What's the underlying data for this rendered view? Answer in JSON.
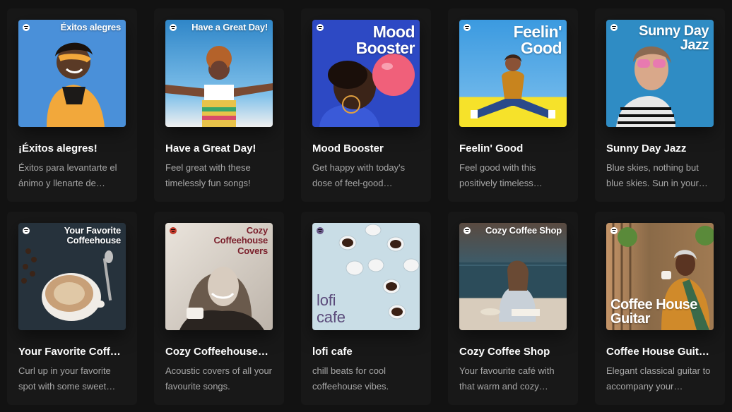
{
  "cards": [
    {
      "title": "¡Éxitos alegres!",
      "description": "Éxitos para levantarte el ánimo y llenarte de…",
      "cover_text": "Éxitos alegres",
      "bg": "#4a90d9"
    },
    {
      "title": "Have a Great Day!",
      "description": "Feel great with these timelessly fun songs!",
      "cover_text": "Have a Great Day!",
      "bg": "#3a8fd0"
    },
    {
      "title": "Mood Booster",
      "description": "Get happy with today's dose of feel-good…",
      "cover_text": "Mood\nBooster",
      "bg": "#2d49c4"
    },
    {
      "title": "Feelin' Good",
      "description": "Feel good with this positively timeless…",
      "cover_text": "Feelin'\nGood",
      "bg": "#3b9ae0"
    },
    {
      "title": "Sunny Day Jazz",
      "description": "Blue skies, nothing but blue skies. Sun in your…",
      "cover_text": "Sunny Day\nJazz",
      "bg": "#2f8cc4"
    },
    {
      "title": "Your Favorite Coff…",
      "description": "Curl up in your favorite spot with some sweet…",
      "cover_text": "Your Favorite\nCoffeehouse",
      "bg": "#2a3440"
    },
    {
      "title": "Cozy Coffeehouse…",
      "description": "Acoustic covers of all your favourite songs.",
      "cover_text": "Cozy\nCoffeehouse\nCovers",
      "bg": "#e8e2da"
    },
    {
      "title": "lofi cafe",
      "description": "chill beats for cool coffeehouse vibes.",
      "cover_text": "lofi\ncafe",
      "bg": "#c9dde6"
    },
    {
      "title": "Cozy Coffee Shop",
      "description": "Your favourite café with that warm and cozy…",
      "cover_text": "Cozy Coffee Shop",
      "bg": "#3f5a66"
    },
    {
      "title": "Coffee House Guit…",
      "description": "Elegant classical guitar to accompany your…",
      "cover_text": "Coffee House\nGuitar",
      "bg": "#8a6a48"
    }
  ]
}
